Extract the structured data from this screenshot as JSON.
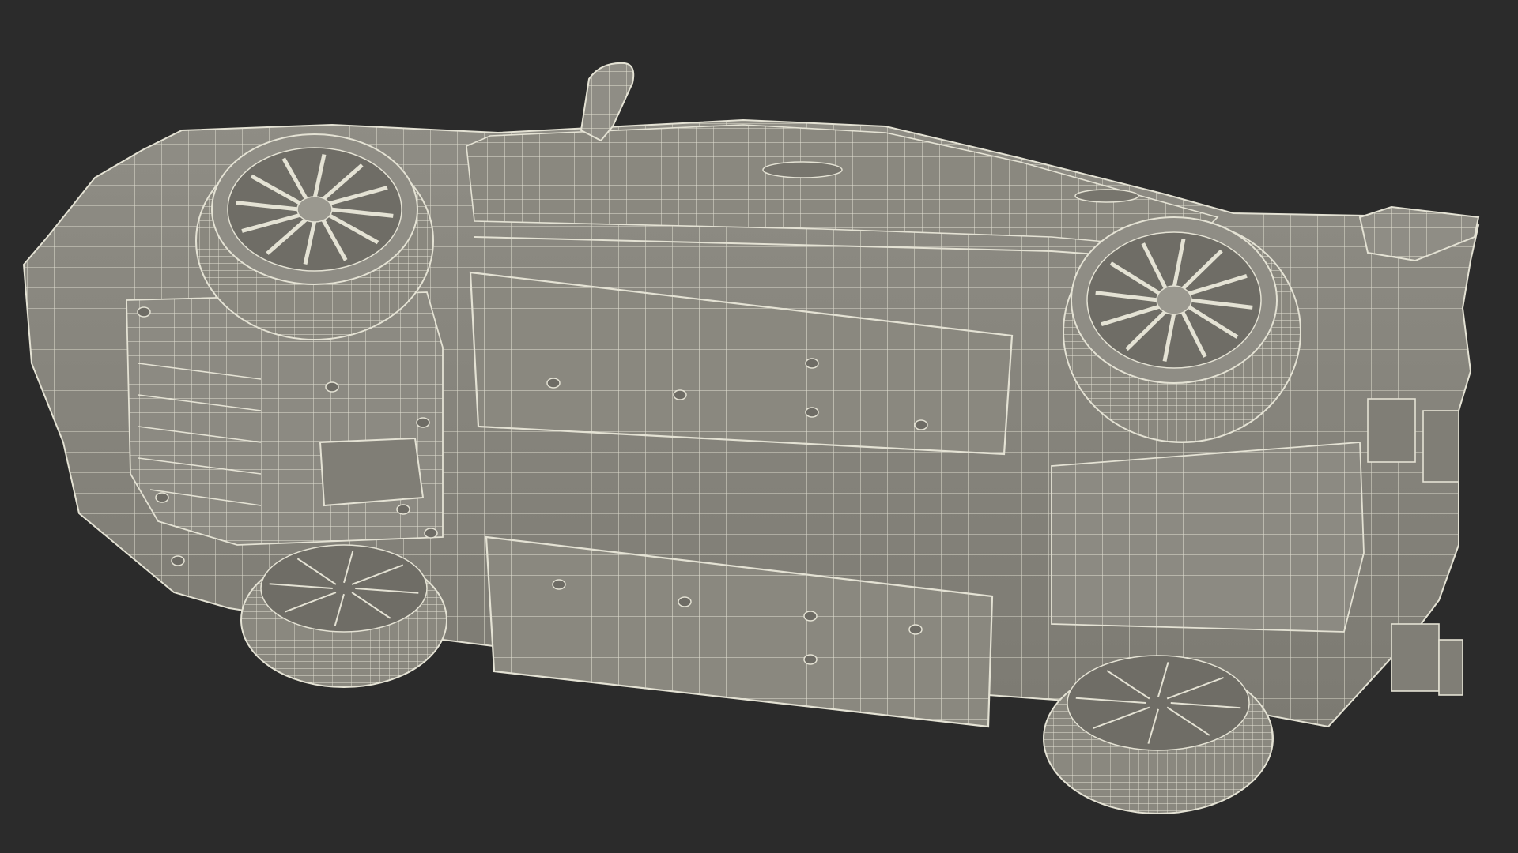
{
  "colors": {
    "background": "#2b2b2b",
    "body_fill": "#85837a",
    "body_fill_light": "#93918a",
    "wire": "#e4e2d4",
    "wire_dim": "#c9c7ba",
    "shadow": "#5f5d56"
  },
  "wheels": {
    "top": {
      "spokes": 12
    },
    "bottom": {
      "spokes": 8
    }
  },
  "screws": {
    "count": 17
  }
}
